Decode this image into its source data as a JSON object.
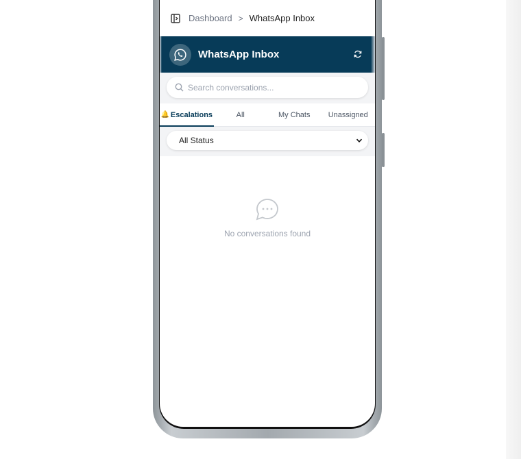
{
  "breadcrumb": {
    "root": "Dashboard",
    "separator": ">",
    "current": "WhatsApp Inbox"
  },
  "header": {
    "title": "WhatsApp Inbox",
    "logo_icon": "whatsapp-icon",
    "refresh_icon": "refresh-icon",
    "bg_color": "#073b58"
  },
  "search": {
    "placeholder": "Search conversations...",
    "value": ""
  },
  "tabs": [
    {
      "label": "Escalations",
      "icon": "bell-icon",
      "active": true
    },
    {
      "label": "All",
      "active": false
    },
    {
      "label": "My Chats",
      "active": false
    },
    {
      "label": "Unassigned",
      "active": false
    }
  ],
  "status_filter": {
    "selected": "All Status"
  },
  "empty_state": {
    "icon": "chat-bubble-icon",
    "message": "No conversations found"
  }
}
